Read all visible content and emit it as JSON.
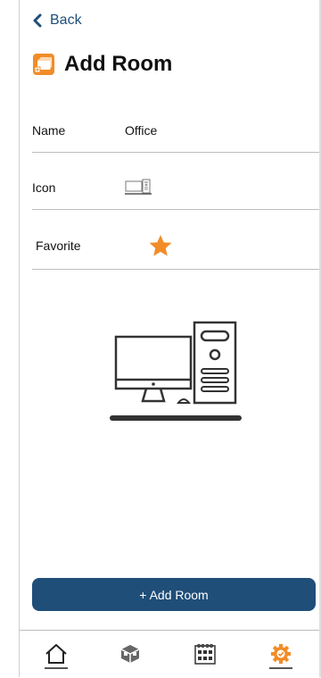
{
  "nav": {
    "back_label": "Back"
  },
  "header": {
    "title": "Add Room",
    "icon": "room-box-icon"
  },
  "fields": [
    {
      "label": "Name",
      "value": "Office"
    },
    {
      "label": "Icon",
      "value_icon": "computer-icon"
    },
    {
      "label": "Favorite",
      "value_icon": "star-icon"
    }
  ],
  "action": {
    "add_label": "+ Add Room"
  },
  "tabs": [
    {
      "name": "home",
      "icon": "home-icon"
    },
    {
      "name": "devices",
      "icon": "device-cube-icon"
    },
    {
      "name": "scenes",
      "icon": "calendar-grid-icon"
    },
    {
      "name": "settings",
      "icon": "gear-icon",
      "active": true
    }
  ],
  "colors": {
    "accent": "#1f4e79",
    "orange": "#f28c28"
  }
}
